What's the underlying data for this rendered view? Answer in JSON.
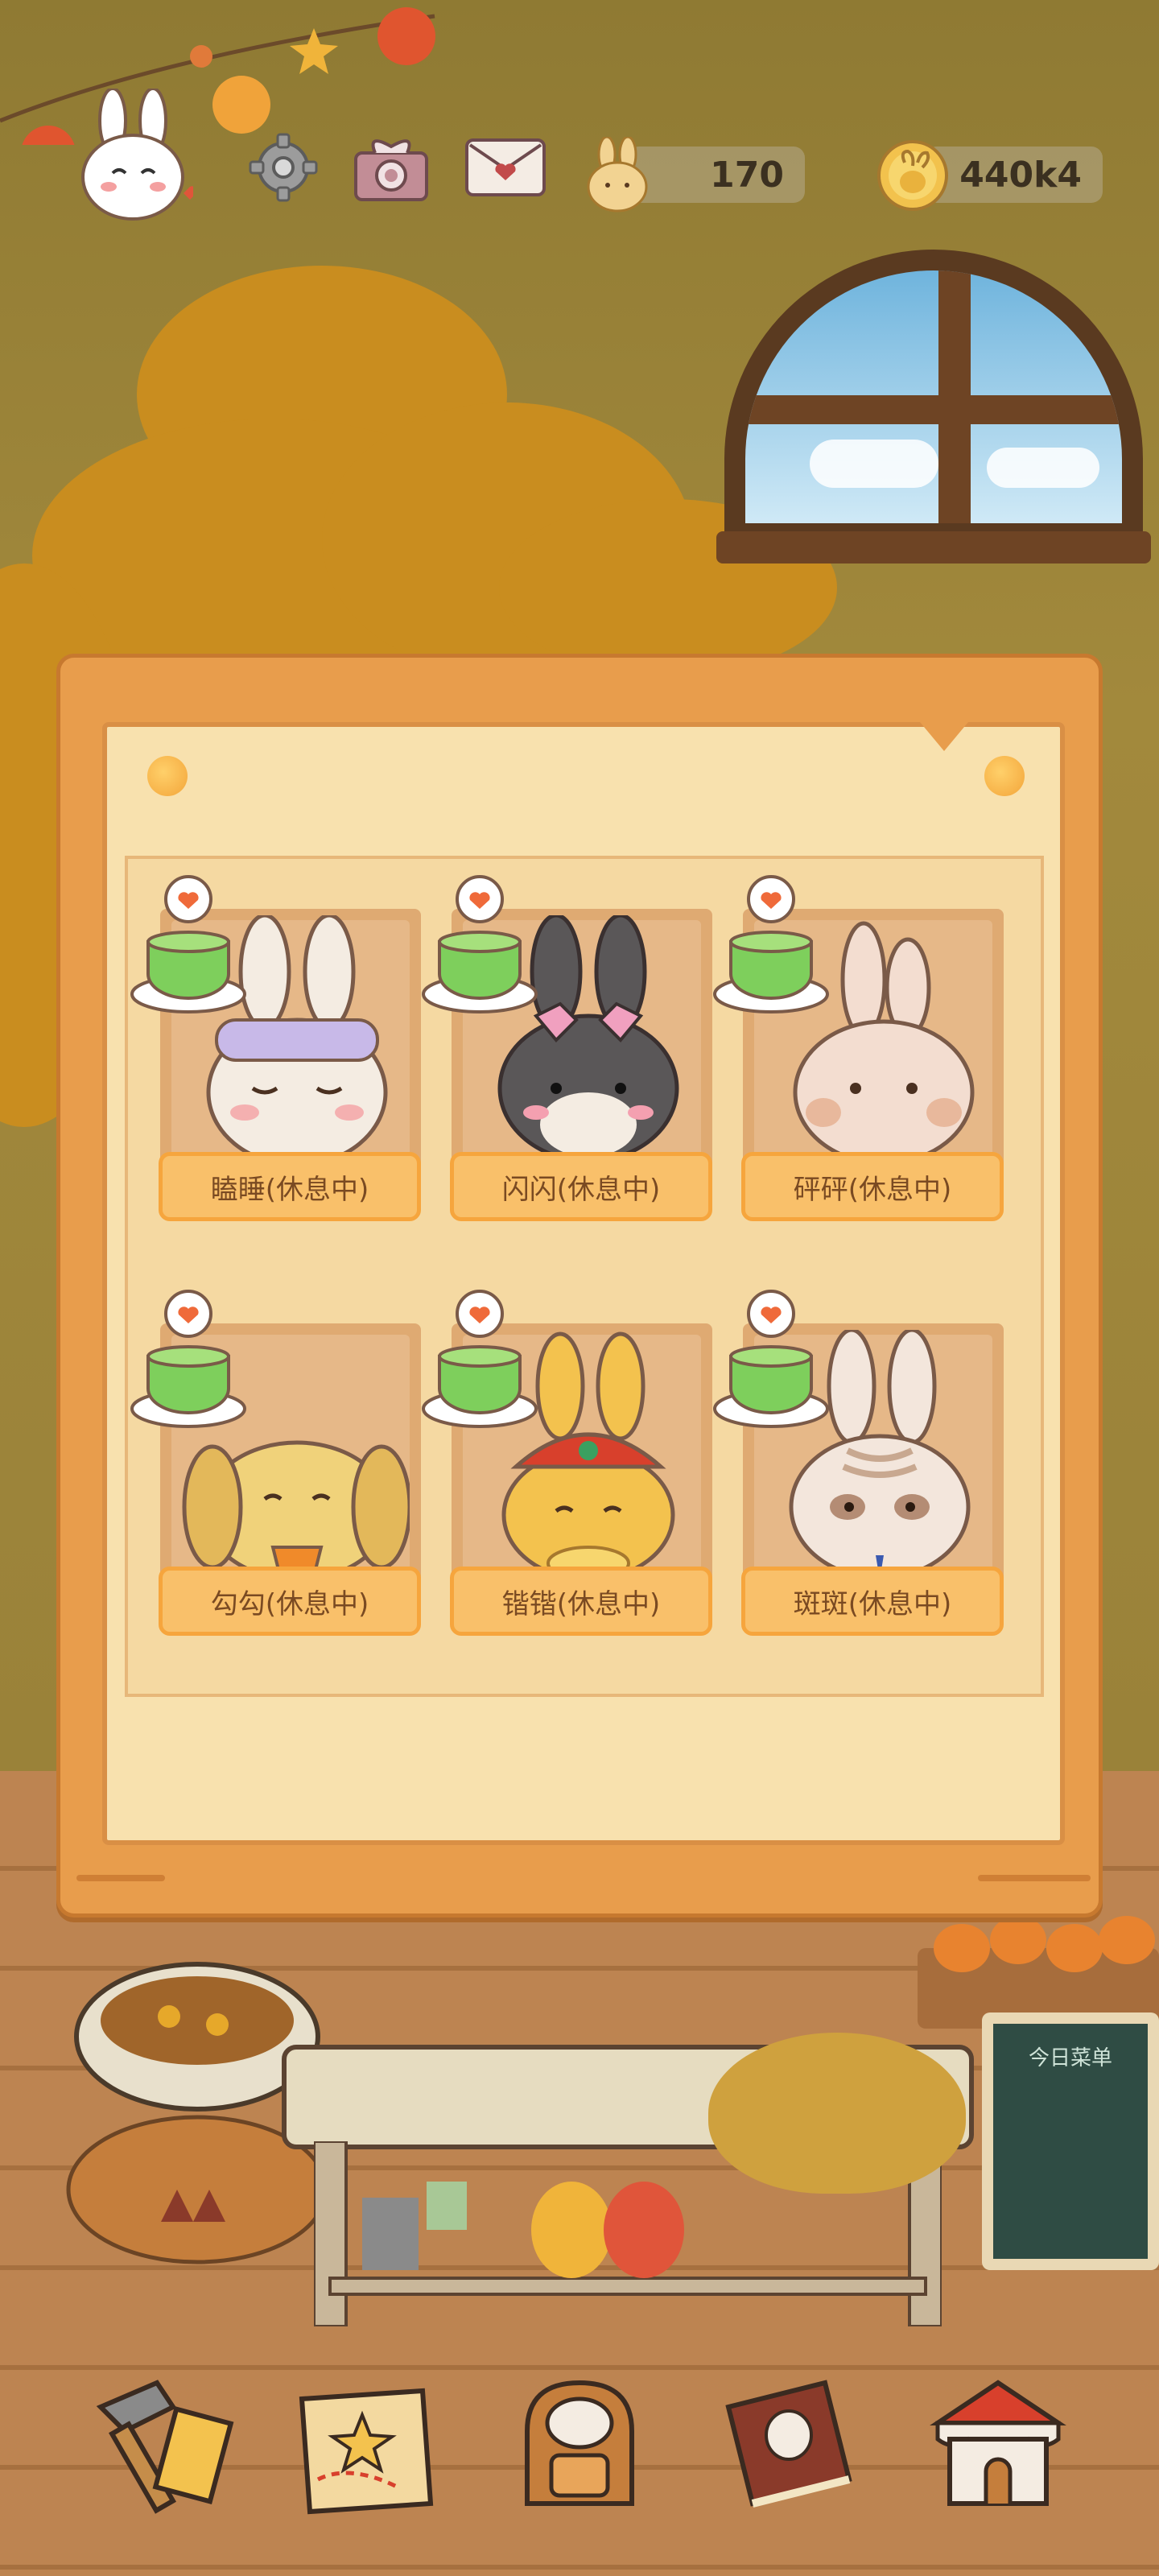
{
  "hud": {
    "settings_icon": "gear-icon",
    "gift_icon": "gift-icon",
    "mail_icon": "mail-heart-icon",
    "carrot_currency": "170",
    "coin_currency": "440k4"
  },
  "panel": {
    "rabbits": [
      {
        "label": "瞌睡(休息中)",
        "color": "#f4ece2"
      },
      {
        "label": "闪闪(休息中)",
        "color": "#5a5758"
      },
      {
        "label": "砰砰(休息中)",
        "color": "#f3ddd0"
      },
      {
        "label": "勾勾(休息中)",
        "color": "#f0d27a"
      },
      {
        "label": "锴锴(休息中)",
        "color": "#f3c24e"
      },
      {
        "label": "斑斑(休息中)",
        "color": "#f3e6dc"
      }
    ]
  },
  "board": {
    "title": "今日菜单"
  },
  "nav": [
    {
      "icon": "hammer-icon"
    },
    {
      "icon": "map-icon"
    },
    {
      "icon": "backpack-icon"
    },
    {
      "icon": "book-icon"
    },
    {
      "icon": "shop-icon"
    }
  ],
  "colors": {
    "panel": "#e89d4c",
    "label": "#f9c06a",
    "label_text": "#7a4a22"
  }
}
